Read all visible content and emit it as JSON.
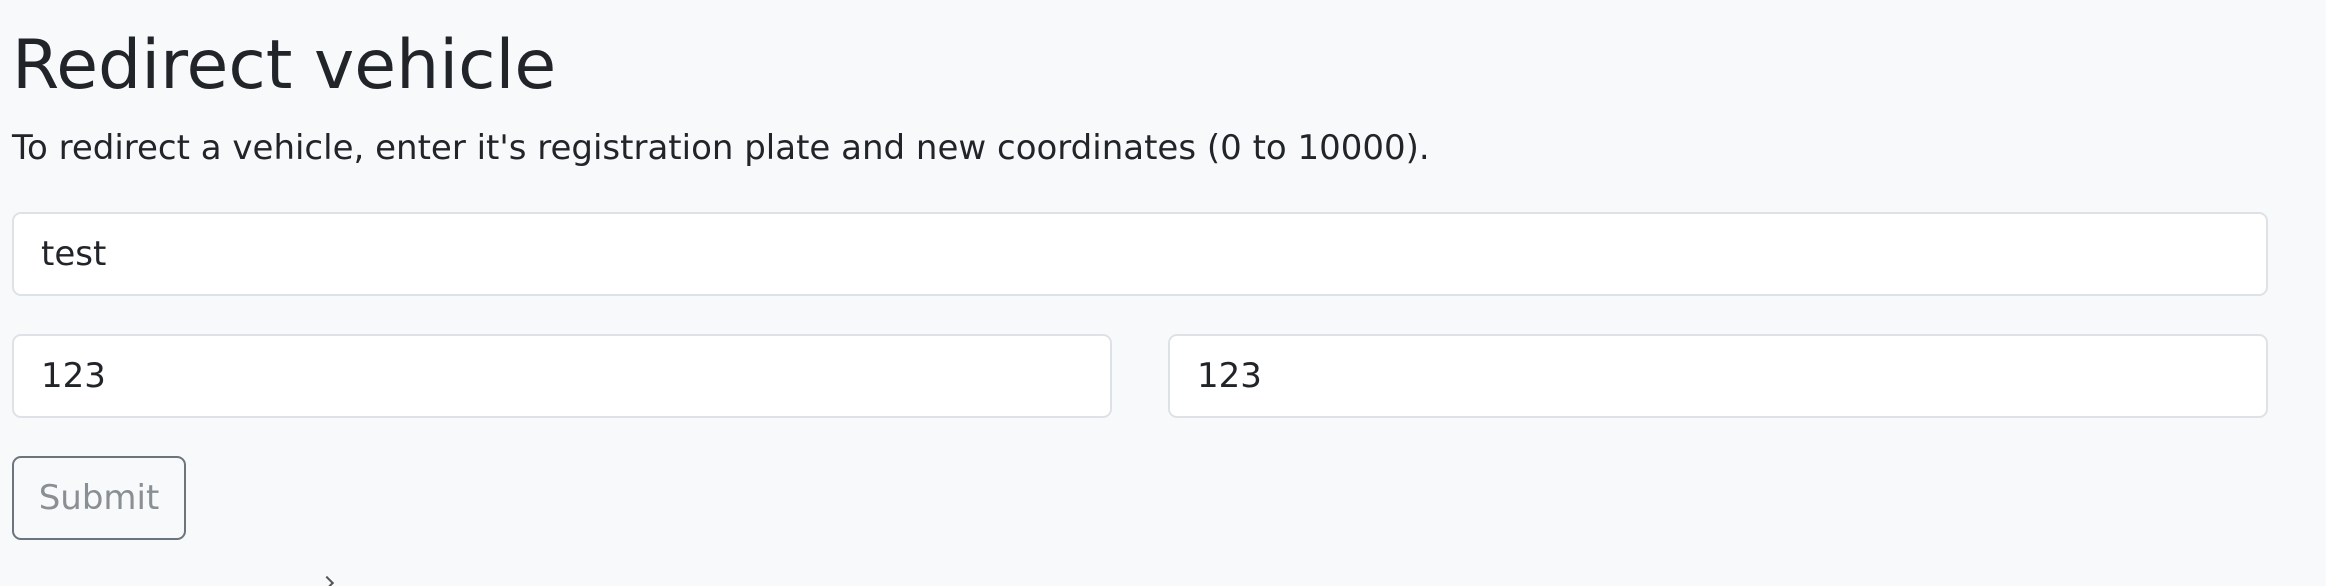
{
  "page": {
    "title": "Redirect vehicle",
    "description": "To redirect a vehicle, enter it's registration plate and new coordinates (0 to 10000)."
  },
  "form": {
    "plate_value": "test",
    "x_value": "123",
    "y_value": "123",
    "submit_label": "Submit"
  },
  "colors": {
    "background": "#f8f9fa",
    "text": "#212529",
    "input_border": "#dee2e6",
    "button_border": "#6c757d"
  }
}
